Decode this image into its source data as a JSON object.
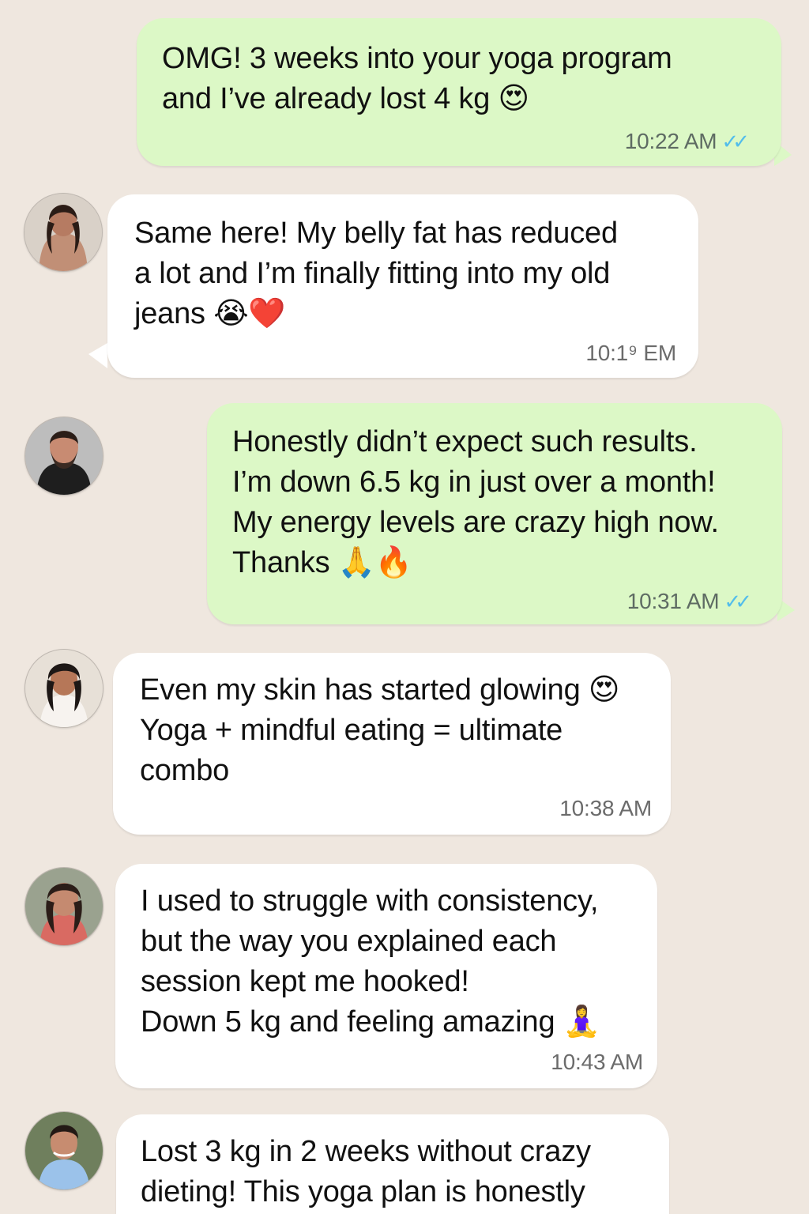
{
  "messages": [
    {
      "text": "OMG! 3 weeks into your yoga program\nand I’ve already lost 4 kg 😍",
      "time": "10:22 AM",
      "status_icon": "double-check-icon",
      "type": "sent"
    },
    {
      "text": "Same here! My belly fat has reduced\na lot and I’m finally fitting into my old\njeans 😭❤️",
      "time": "10:1⁹ EM",
      "type": "received"
    },
    {
      "text": "Honestly didn’t expect such results.\nI’m down 6.5 kg in just over a month!\nMy energy levels are crazy high now.\nThanks 🙏🔥",
      "time": "10:31 AM",
      "status_icon": "double-check-icon",
      "type": "sent"
    },
    {
      "text": "Even my skin has started glowing 😍\nYoga + mindful eating = ultimate\ncombo",
      "time": "10:38 AM",
      "type": "received"
    },
    {
      "text": "I used to struggle with consistency,\nbut the way you explained each\nsession kept me hooked!\nDown 5 kg and feeling amazing 🧘‍♀️",
      "time": "10:43 AM",
      "type": "received"
    },
    {
      "text": "Lost 3 kg in 2 weeks without crazy\ndieting! This yoga plan is honestly",
      "time": "",
      "type": "received"
    }
  ],
  "colors": {
    "background": "#efe7df",
    "sent_bubble": "#dcf8c6",
    "received_bubble": "#ffffff",
    "read_ticks": "#53bdeb"
  }
}
